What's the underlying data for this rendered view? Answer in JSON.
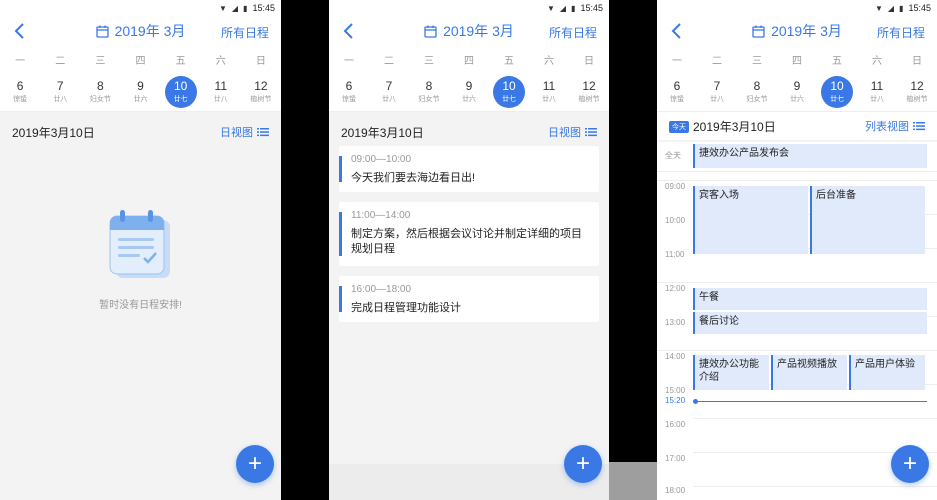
{
  "status": {
    "time": "15:45"
  },
  "nav": {
    "title": "2019年 3月",
    "right": "所有日程"
  },
  "weekdays": [
    "一",
    "二",
    "三",
    "四",
    "五",
    "六",
    "日"
  ],
  "dates": [
    {
      "d": "6",
      "l": "惊蛰"
    },
    {
      "d": "7",
      "l": "廿八"
    },
    {
      "d": "8",
      "l": "妇女节"
    },
    {
      "d": "9",
      "l": "廿六"
    },
    {
      "d": "10",
      "l": "廿七"
    },
    {
      "d": "11",
      "l": "廿八"
    },
    {
      "d": "12",
      "l": "植树节"
    }
  ],
  "selected_index": 4,
  "screen1": {
    "date_title": "2019年3月10日",
    "view_label": "日视图",
    "empty_text": "暂时没有日程安排!"
  },
  "screen2": {
    "date_title": "2019年3月10日",
    "view_label": "日视图",
    "events": [
      {
        "time": "09:00—10:00",
        "title": "今天我们要去海边看日出!"
      },
      {
        "time": "11:00—14:00",
        "title": "制定方案，然后根据会议讨论并制定详细的项目规划日程"
      },
      {
        "time": "16:00—18:00",
        "title": "完成日程管理功能设计"
      }
    ]
  },
  "screen3": {
    "today_badge": "今天",
    "date_title": "2019年3月10日",
    "view_label": "列表视图",
    "allday_label": "全天",
    "allday_event": "捷效办公产品发布会",
    "hours": [
      "09:00",
      "10:00",
      "11:00",
      "12:00",
      "13:00",
      "14:00",
      "15:00",
      "16:00",
      "17:00",
      "18:00"
    ],
    "now_label": "15:20",
    "events": [
      {
        "title": "宾客入场"
      },
      {
        "title": "后台准备"
      },
      {
        "title": "午餐"
      },
      {
        "title": "餐后讨论"
      },
      {
        "title": "捷效办公功能介绍"
      },
      {
        "title": "产品视频播放"
      },
      {
        "title": "产品用户体验"
      }
    ]
  },
  "colors": {
    "accent": "#3a78e6",
    "event_bg": "#e0eafb",
    "background": "#f3f3f3"
  },
  "icons": {
    "back": "chevron-left-icon",
    "calendar": "calendar-icon",
    "list": "list-icon",
    "add": "plus-icon"
  }
}
